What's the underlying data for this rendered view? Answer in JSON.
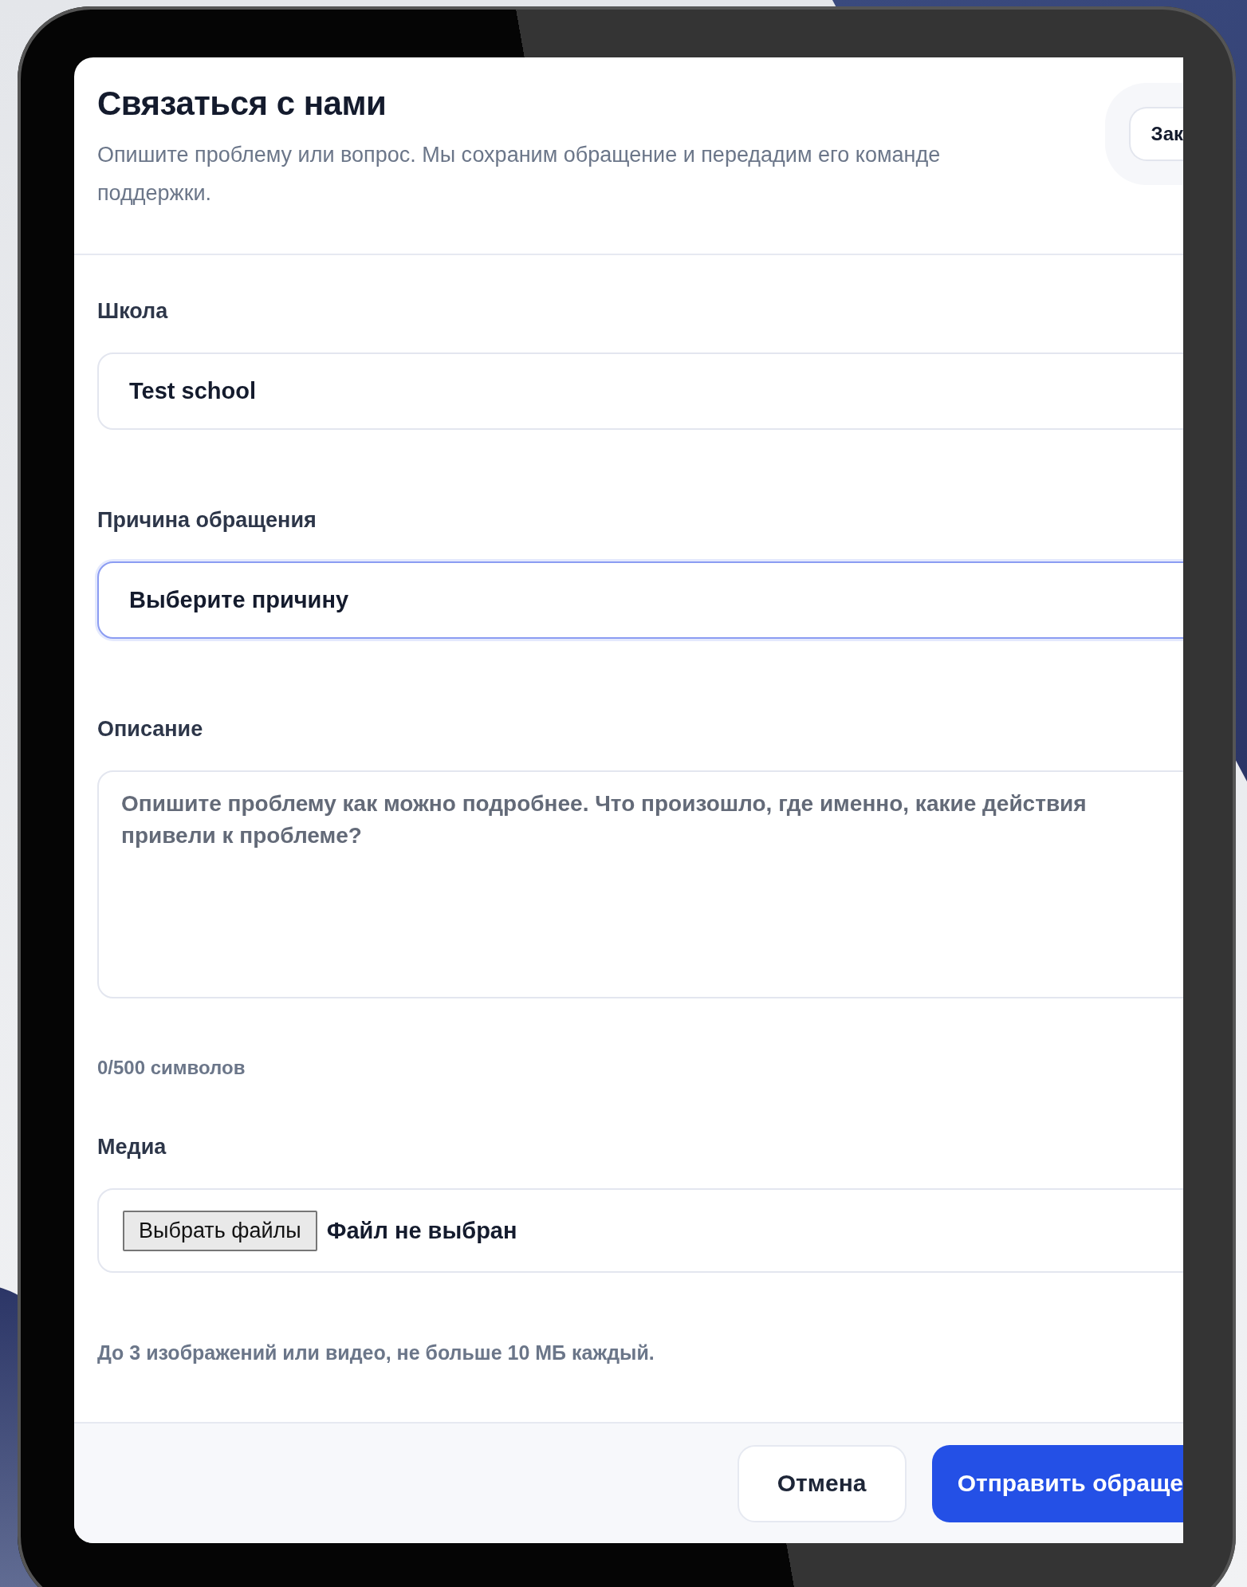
{
  "dialog": {
    "title": "Связаться с нами",
    "subtitle": "Опишите проблему или вопрос. Мы сохраним обращение и передадим его команде поддержки.",
    "close_button": "Зак"
  },
  "fields": [
    {
      "kind": "input",
      "label": "Школа",
      "value": "Test school",
      "focused": false
    },
    {
      "kind": "select",
      "label": "Причина обращения",
      "value": "Выберите причину",
      "focused": true
    },
    {
      "kind": "textarea",
      "label": "Описание",
      "placeholder": "Опишите проблему как можно подробнее. Что произошло, где именно, какие действия привели к проблеме?",
      "counter": "0/500 символов"
    },
    {
      "kind": "file",
      "label": "Медиа",
      "button": "Выбрать файлы",
      "status": "Файл не выбран",
      "hint": "До 3 изображений или видео, не больше 10 МБ каждый."
    }
  ],
  "footer": {
    "buttons": [
      {
        "label": "Отмена",
        "kind": "secondary"
      },
      {
        "label": "Отправить обраще",
        "kind": "primary"
      }
    ]
  }
}
